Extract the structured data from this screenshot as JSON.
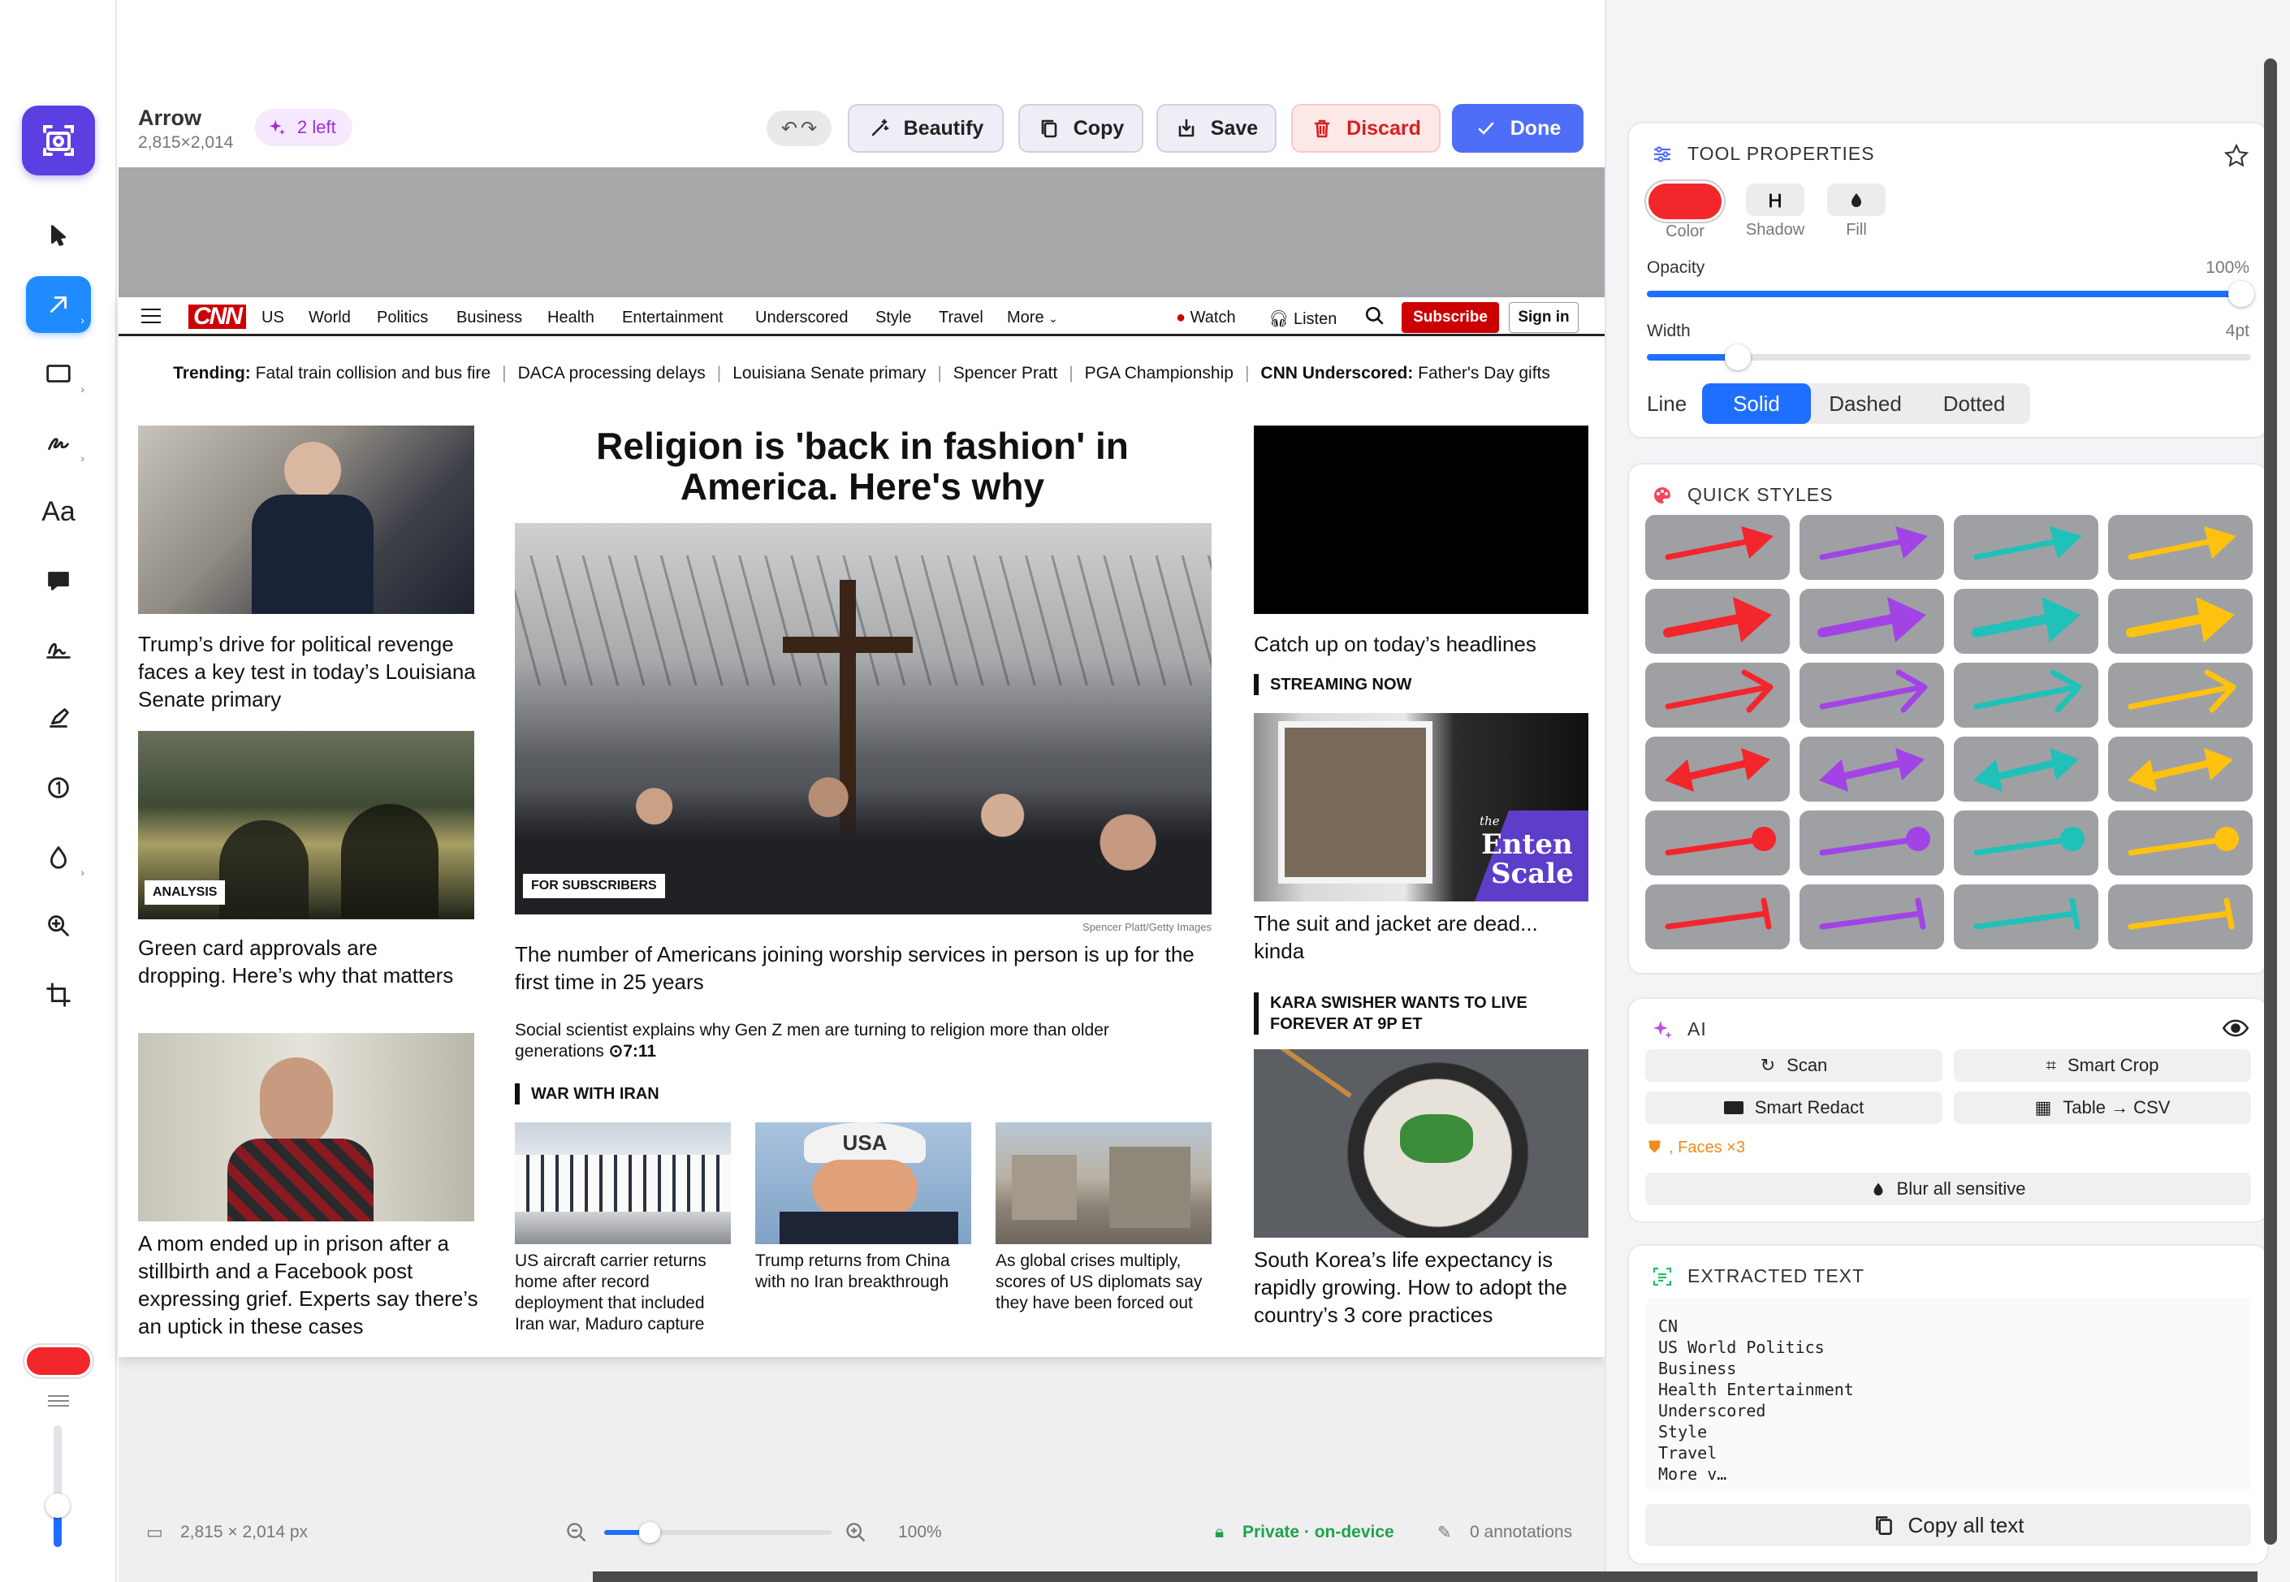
{
  "toolbar": {
    "file_name": "Arrow",
    "file_dims": "2,815×2,014",
    "ai_badge": "2 left",
    "beautify": "Beautify",
    "copy": "Copy",
    "save": "Save",
    "discard": "Discard",
    "done": "Done"
  },
  "left_tools": {
    "text_tool": "Aa",
    "active": "arrow"
  },
  "status": {
    "size": "2,815 × 2,014 px",
    "zoom": "100%",
    "privacy": "Private · on-device",
    "annotations": "0 annotations",
    "zoom_level": 0.2
  },
  "cnn": {
    "nav": [
      "US",
      "World",
      "Politics",
      "Business",
      "Health",
      "Entertainment",
      "Underscored",
      "Style",
      "Travel",
      "More"
    ],
    "logo": "CNN",
    "watch": "Watch",
    "listen": "Listen",
    "subscribe": "Subscribe",
    "signin": "Sign in",
    "trending_label": "Trending:",
    "trending": [
      "Fatal train collision and bus fire",
      "DACA processing delays",
      "Louisiana Senate primary",
      "Spencer Pratt",
      "PGA Championship"
    ],
    "underscored_label": "CNN Underscored:",
    "underscored_text": "Father's Day gifts",
    "left_col": [
      {
        "headline": "Trump’s drive for political revenge faces a key test in today’s Louisiana Senate primary"
      },
      {
        "tag": "ANALYSIS",
        "headline": "Green card approvals are dropping. Here’s why that matters"
      },
      {
        "headline": "A mom ended up in prison after a stillbirth and a Facebook post expressing grief. Experts say there’s an uptick in these cases"
      }
    ],
    "main": {
      "title": "Religion is 'back in fashion' in America. Here's why",
      "tag": "FOR SUBSCRIBERS",
      "credit": "Spencer Platt/Getty Images",
      "headline": "The number of Americans joining worship services in person is up for the first time in 25 years",
      "sub": "Social scientist explains why Gen Z men are turning to religion more than older generations",
      "duration": "7:11"
    },
    "war_section": "WAR WITH IRAN",
    "war_items": [
      "US aircraft carrier returns home after record deployment that included Iran war, Maduro capture",
      "Trump returns from China with no Iran breakthrough",
      "As global crises multiply, scores of US diplomats say they have been forced out"
    ],
    "usa_cap": "USA",
    "right_col": {
      "video_caption": "Catch up on today’s headlines",
      "streaming": "STREAMING NOW",
      "enten_small": "the",
      "enten1": "Enten",
      "enten2": "Scale",
      "stream_headline": "The suit and jacket are dead... kinda",
      "kara": "KARA SWISHER WANTS TO LIVE FOREVER AT 9P ET",
      "korea": "South Korea’s life expectancy is rapidly growing. How to adopt the country’s 3 core practices"
    }
  },
  "panel": {
    "tool_props": {
      "title": "TOOL PROPERTIES",
      "color_label": "Color",
      "shadow_label": "Shadow",
      "fill_label": "Fill",
      "color": "#f2262b",
      "opacity_label": "Opacity",
      "opacity_value": "100%",
      "opacity": 1.0,
      "width_label": "Width",
      "width_value": "4pt",
      "width_frac": 0.15,
      "line_label": "Line",
      "line_styles": [
        "Solid",
        "Dashed",
        "Dotted"
      ],
      "line_active": "Solid"
    },
    "quick_styles": {
      "title": "QUICK STYLES",
      "colors": [
        "#f2262b",
        "#a243e6",
        "#1fc1b8",
        "#ffc20e"
      ],
      "rows": [
        "arrow",
        "fat-arrow",
        "open-arrow",
        "double-arrow",
        "dot-end",
        "bar-end"
      ]
    },
    "ai": {
      "title": "AI",
      "scan": "Scan",
      "smart_crop": "Smart Crop",
      "smart_redact": "Smart Redact",
      "table_csv": "Table → CSV",
      "faces": ", Faces ×3",
      "blur": "Blur all sensitive"
    },
    "extracted": {
      "title": "EXTRACTED TEXT",
      "lines": [
        "CN",
        "US World Politics",
        "Business",
        "Health Entertainment",
        "Underscored",
        "Style",
        "Travel",
        "More v…"
      ],
      "copy_all": "Copy all text"
    }
  },
  "colors": {
    "accent": "#5b3fe0",
    "blue": "#1f8bff",
    "red": "#f2262b",
    "cnn_red": "#cc0000"
  }
}
